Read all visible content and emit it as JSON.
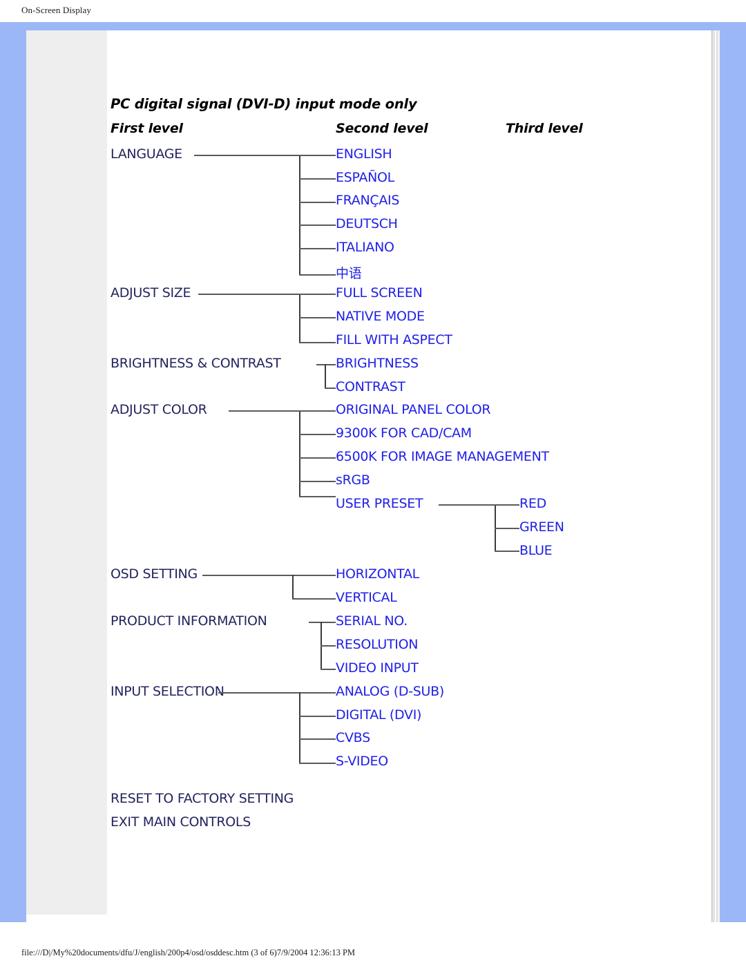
{
  "document": {
    "header": "On-Screen Display",
    "footer": "file:///D|/My%20documents/dfu/J/english/200p4/osd/osddesc.htm (3 of 6)7/9/2004 12:36:13 PM"
  },
  "colors": {
    "frame_blue": "#9cb7f8",
    "side_column_grey": "#eeeeee",
    "level1_text": "#23235e",
    "level2_text": "#2020e8",
    "level3_text": "#2020e8",
    "connector_line": "#5a5a5a"
  },
  "diagram": {
    "title": "PC digital signal (DVI-D) input mode only",
    "column_headers": {
      "first": "First level",
      "second": "Second level",
      "third": "Third level"
    },
    "groups": [
      {
        "first": "LANGUAGE",
        "second": [
          "ENGLISH",
          "ESPAÑOL",
          "FRANÇAIS",
          "DEUTSCH",
          "ITALIANO",
          "中语"
        ]
      },
      {
        "first": "ADJUST SIZE",
        "second": [
          "FULL SCREEN",
          "NATIVE MODE",
          "FILL WITH ASPECT"
        ]
      },
      {
        "first": "BRIGHTNESS & CONTRAST",
        "second": [
          "BRIGHTNESS",
          "CONTRAST"
        ]
      },
      {
        "first": "ADJUST COLOR",
        "second": [
          "ORIGINAL PANEL COLOR",
          "9300K FOR CAD/CAM",
          "6500K FOR IMAGE MANAGEMENT",
          "sRGB",
          "USER PRESET"
        ],
        "third_parent": "USER PRESET",
        "third": [
          "RED",
          "GREEN",
          "BLUE"
        ]
      },
      {
        "first": "OSD SETTING",
        "second": [
          "HORIZONTAL",
          "VERTICAL"
        ]
      },
      {
        "first": "PRODUCT INFORMATION",
        "second": [
          "SERIAL NO.",
          "RESOLUTION",
          "VIDEO INPUT"
        ]
      },
      {
        "first": "INPUT SELECTION",
        "second": [
          "ANALOG (D-SUB)",
          "DIGITAL (DVI)",
          "CVBS",
          "S-VIDEO"
        ]
      }
    ],
    "standalone": [
      "RESET TO FACTORY SETTING",
      "EXIT MAIN CONTROLS"
    ]
  }
}
